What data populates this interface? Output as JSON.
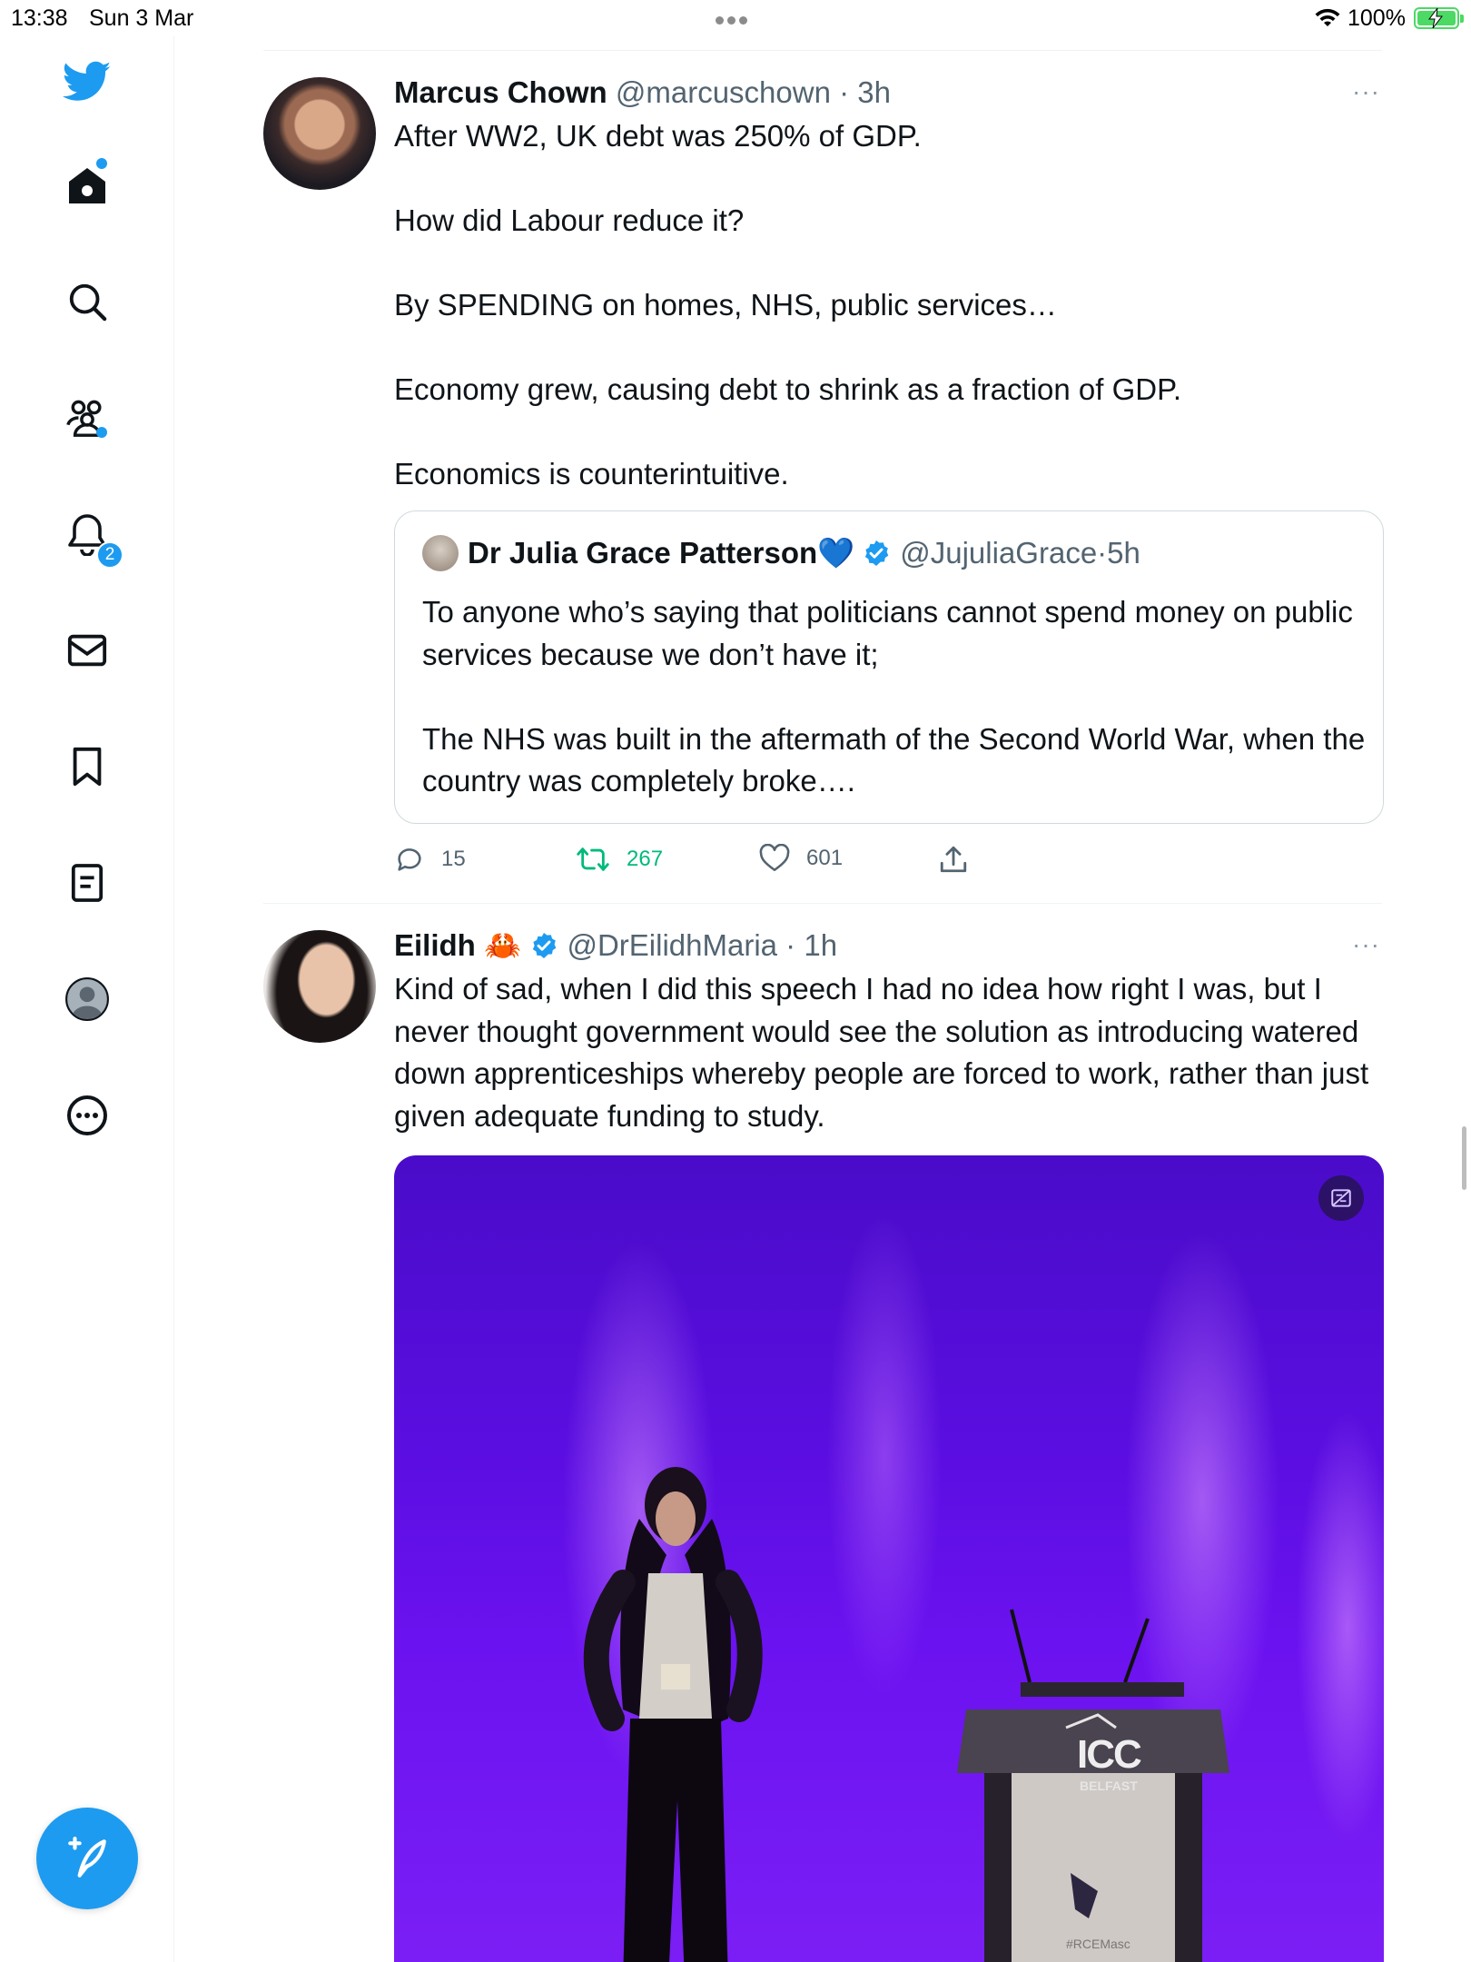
{
  "status_bar": {
    "time": "13:38",
    "date": "Sun 3 Mar",
    "battery": "100%"
  },
  "sidebar": {
    "items": [
      {
        "name": "home",
        "icon": "home-icon",
        "has_dot": true
      },
      {
        "name": "explore",
        "icon": "search-icon"
      },
      {
        "name": "communities",
        "icon": "communities-icon",
        "has_dot": true
      },
      {
        "name": "notifications",
        "icon": "bell-icon",
        "badge": "2"
      },
      {
        "name": "messages",
        "icon": "mail-icon"
      },
      {
        "name": "bookmarks",
        "icon": "bookmark-icon"
      },
      {
        "name": "lists",
        "icon": "lists-icon"
      },
      {
        "name": "profile",
        "icon": "avatar-icon"
      },
      {
        "name": "more",
        "icon": "more-circle-icon"
      }
    ],
    "compose_icon": "compose-feather-icon",
    "accent_color": "#1d9bf0"
  },
  "feed": {
    "tweets": [
      {
        "name": "Marcus Chown",
        "handle": "@marcuschown",
        "time": "3h",
        "more": "···",
        "paragraphs": [
          "After WW2, UK debt was 250% of GDP.",
          "How did Labour reduce it?",
          "By SPENDING on homes, NHS, public services…",
          "Economy grew, causing debt to shrink as a fraction of GDP.",
          "Economics is counterintuitive."
        ],
        "quote": {
          "name": "Dr Julia Grace Patterson💙",
          "handle": "@JujuliaGrace",
          "time": "5h",
          "paragraphs": [
            "To anyone who’s saying that politicians cannot spend money on public services because we don’t have it;",
            "The NHS was built in the aftermath of the Second World War, when the country was completely broke…."
          ]
        },
        "actions": {
          "replies": "15",
          "retweets": "267",
          "likes": "601"
        }
      },
      {
        "name": "Eilidh",
        "emoji": "🦀",
        "handle": "@DrEilidhMaria",
        "time": "1h",
        "more": "···",
        "paragraphs": [
          "Kind of sad, when I did this speech I had no idea how right I was, but I never thought government would see the solution as introducing watered down apprenticeships whereby people are forced to work, rather than just given adequate funding to study."
        ],
        "media": {
          "podium_logo": "ICC",
          "podium_sub": "BELFAST",
          "podium_tag": "#RCEMasc"
        }
      }
    ]
  }
}
